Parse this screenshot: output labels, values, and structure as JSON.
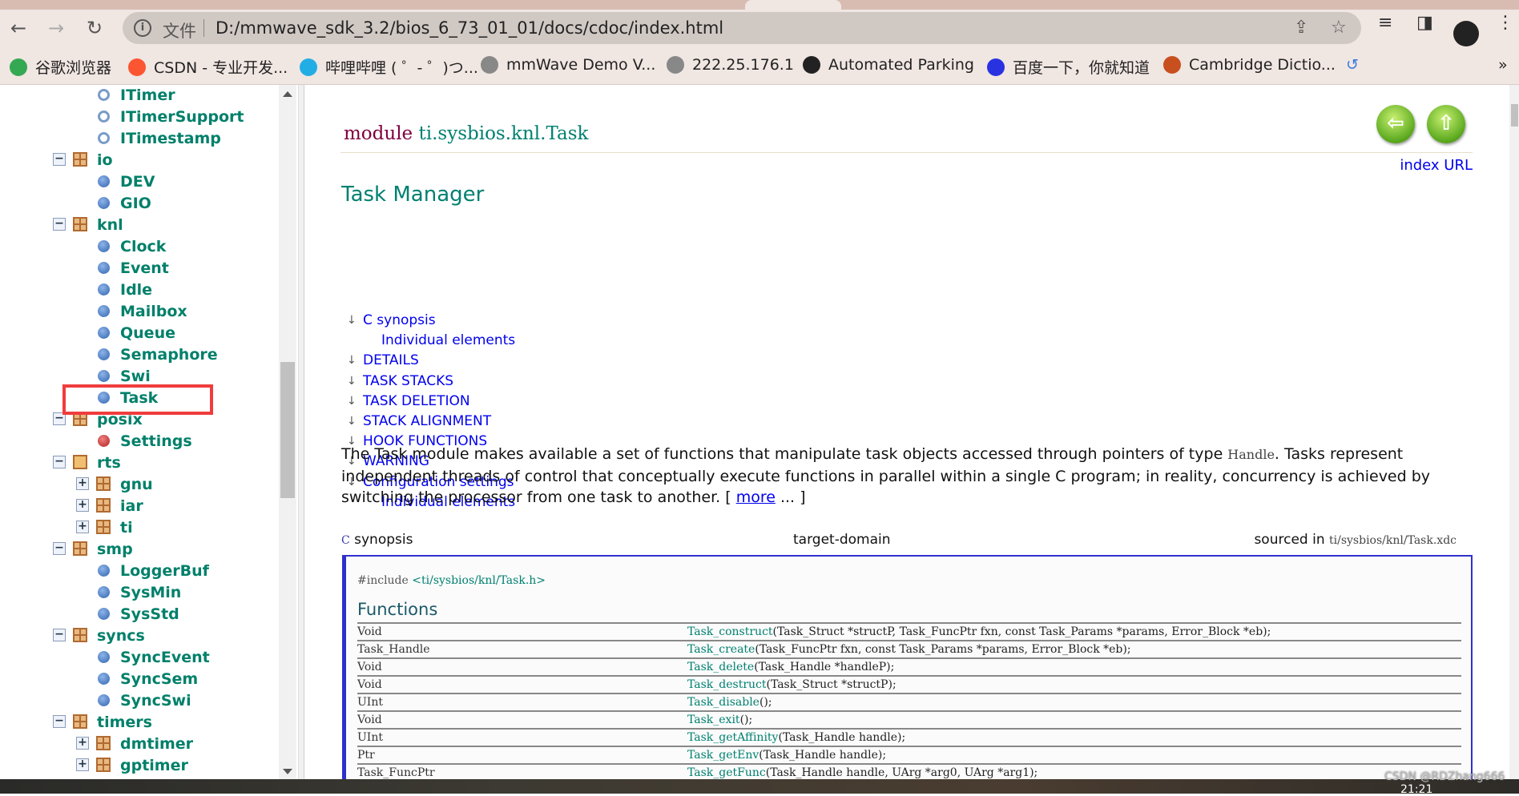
{
  "browser": {
    "file_label": "文件",
    "url": "D:/mmwave_sdk_3.2/bios_6_73_01_01/docs/cdoc/index.html",
    "bookmarks": [
      {
        "label": "谷歌浏览器",
        "icon": "chrome-icon",
        "color": "#34a853"
      },
      {
        "label": "CSDN - 专业开发...",
        "icon": "csdn-icon",
        "color": "#fc5531"
      },
      {
        "label": "哔哩哔哩 ( ゜- ゜)つ...",
        "icon": "bilibili-icon",
        "color": "#23ade5"
      },
      {
        "label": "mmWave Demo V...",
        "icon": "globe-icon",
        "color": "#888888"
      },
      {
        "label": "222.25.176.1",
        "icon": "globe-icon",
        "color": "#888888"
      },
      {
        "label": "Automated Parking",
        "icon": "compass-icon",
        "color": "#222222"
      },
      {
        "label": "百度一下，你就知道",
        "icon": "baidu-icon",
        "color": "#2932e1"
      },
      {
        "label": "Cambridge Dictio...",
        "icon": "cambridge-icon",
        "color": "#c8501e"
      }
    ]
  },
  "sidebar": {
    "selected": "Task",
    "items": [
      {
        "label": "ITimer",
        "level": 2,
        "kind": "interface"
      },
      {
        "label": "ITimerSupport",
        "level": 2,
        "kind": "interface"
      },
      {
        "label": "ITimestamp",
        "level": 2,
        "kind": "interface"
      },
      {
        "label": "io",
        "level": 1,
        "kind": "package",
        "expander": "−"
      },
      {
        "label": "DEV",
        "level": 2,
        "kind": "module"
      },
      {
        "label": "GIO",
        "level": 2,
        "kind": "module"
      },
      {
        "label": "knl",
        "level": 1,
        "kind": "package",
        "expander": "−"
      },
      {
        "label": "Clock",
        "level": 2,
        "kind": "module"
      },
      {
        "label": "Event",
        "level": 2,
        "kind": "module"
      },
      {
        "label": "Idle",
        "level": 2,
        "kind": "module"
      },
      {
        "label": "Mailbox",
        "level": 2,
        "kind": "module"
      },
      {
        "label": "Queue",
        "level": 2,
        "kind": "module"
      },
      {
        "label": "Semaphore",
        "level": 2,
        "kind": "module"
      },
      {
        "label": "Swi",
        "level": 2,
        "kind": "module"
      },
      {
        "label": "Task",
        "level": 2,
        "kind": "module"
      },
      {
        "label": "posix",
        "level": 1,
        "kind": "package",
        "expander": "−"
      },
      {
        "label": "Settings",
        "level": 2,
        "kind": "settings"
      },
      {
        "label": "rts",
        "level": 1,
        "kind": "package-open",
        "expander": "−"
      },
      {
        "label": "gnu",
        "level": 2,
        "kind": "package",
        "expander": "+"
      },
      {
        "label": "iar",
        "level": 2,
        "kind": "package",
        "expander": "+"
      },
      {
        "label": "ti",
        "level": 2,
        "kind": "package",
        "expander": "+"
      },
      {
        "label": "smp",
        "level": 1,
        "kind": "package",
        "expander": "−"
      },
      {
        "label": "LoggerBuf",
        "level": 2,
        "kind": "module"
      },
      {
        "label": "SysMin",
        "level": 2,
        "kind": "module"
      },
      {
        "label": "SysStd",
        "level": 2,
        "kind": "module"
      },
      {
        "label": "syncs",
        "level": 1,
        "kind": "package",
        "expander": "−"
      },
      {
        "label": "SyncEvent",
        "level": 2,
        "kind": "module"
      },
      {
        "label": "SyncSem",
        "level": 2,
        "kind": "module"
      },
      {
        "label": "SyncSwi",
        "level": 2,
        "kind": "module"
      },
      {
        "label": "timers",
        "level": 1,
        "kind": "package",
        "expander": "−"
      },
      {
        "label": "dmtimer",
        "level": 2,
        "kind": "package",
        "expander": "+"
      },
      {
        "label": "gptimer",
        "level": 2,
        "kind": "package",
        "expander": "+"
      }
    ]
  },
  "main": {
    "title_keyword": "module",
    "title_name": "ti.sysbios.knl.Task",
    "index_url": "index URL",
    "heading": "Task Manager",
    "toc": [
      {
        "label": "C synopsis",
        "indent": false
      },
      {
        "label": "Individual elements",
        "indent": true
      },
      {
        "label": "DETAILS",
        "indent": false
      },
      {
        "label": "TASK STACKS",
        "indent": false
      },
      {
        "label": "TASK DELETION",
        "indent": false
      },
      {
        "label": "STACK ALIGNMENT",
        "indent": false
      },
      {
        "label": "HOOK FUNCTIONS",
        "indent": false
      },
      {
        "label": "WARNING",
        "indent": false
      },
      {
        "label": "Configuration settings",
        "indent": false
      },
      {
        "label": "Individual elements",
        "indent": true
      }
    ],
    "para_1": "The Task module makes available a set of functions that manipulate task objects accessed through pointers of type ",
    "para_code": "Handle",
    "para_2": ". Tasks represent independent threads of control that conceptually execute functions in parallel within a single C program; in reality, concurrency is achieved by switching the processor from one task to another. [ ",
    "para_more": "more",
    "para_3": " ... ]",
    "synopsis": {
      "c_label": "C",
      "label": "synopsis",
      "target": "target-domain",
      "sourced_label": "sourced in",
      "sourced_path": "ti/sysbios/knl/Task.xdc",
      "include_kw": "#include",
      "include_path": "<ti/sysbios/knl/Task.h>",
      "functions_heading": "Functions",
      "functions": [
        {
          "type": "Void",
          "name": "Task_construct",
          "args": "(Task_Struct *structP, Task_FuncPtr  fxn, const Task_Params *params, Error_Block *eb);"
        },
        {
          "type": "Task_Handle",
          "name": "Task_create",
          "args": "(Task_FuncPtr  fxn, const Task_Params *params, Error_Block *eb);"
        },
        {
          "type": "Void",
          "name": "Task_delete",
          "args": "(Task_Handle *handleP);"
        },
        {
          "type": "Void",
          "name": "Task_destruct",
          "args": "(Task_Struct *structP);"
        },
        {
          "type": "UInt",
          "name": "Task_disable",
          "args": "();"
        },
        {
          "type": "Void",
          "name": "Task_exit",
          "args": "();"
        },
        {
          "type": "UInt",
          "name": "Task_getAffinity",
          "args": "(Task_Handle handle);"
        },
        {
          "type": "Ptr",
          "name": "Task_getEnv",
          "args": "(Task_Handle handle);"
        },
        {
          "type": "Task_FuncPtr",
          "name": "Task_getFunc",
          "args": "(Task_Handle handle, UArg  *arg0, UArg  *arg1);"
        }
      ]
    }
  },
  "watermark": "CSDN @RDZhang666",
  "clock": "21:21"
}
